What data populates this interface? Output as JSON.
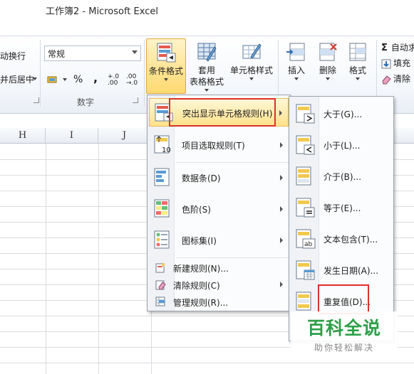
{
  "window": {
    "title": "工作簿2 - Microsoft Excel"
  },
  "ribbon": {
    "wrap_text_label": "动换行",
    "merge_center_label": "并后居中",
    "number_format_value": "常规",
    "number_group_label": "数字",
    "percent_symbol": "%",
    "comma_symbol": ",",
    "inc_decimal_label": "+.0 .00",
    "dec_decimal_label": ".00 →.0",
    "conditional_format_label": "条件格式",
    "table_format_label1": "套用",
    "table_format_label2": "表格格式",
    "cell_style_label": "单元格样式",
    "insert_label": "插入",
    "delete_label": "删除",
    "format_label": "格式",
    "autosum_label": "自动求",
    "fill_label": "填充",
    "clear_label": "清除",
    "sigma_symbol": "Σ"
  },
  "grid": {
    "columns": [
      "H",
      "I",
      "J"
    ]
  },
  "conditional_menu": {
    "items": [
      {
        "label": "突出显示单元格规则(H)",
        "icon": "highlight-rules-icon"
      },
      {
        "label": "项目选取规则(T)",
        "icon": "top-bottom-rules-icon"
      },
      {
        "label": "数据条(D)",
        "icon": "data-bars-icon"
      },
      {
        "label": "色阶(S)",
        "icon": "color-scales-icon"
      },
      {
        "label": "图标集(I)",
        "icon": "icon-sets-icon"
      }
    ],
    "small_items": [
      {
        "label": "新建规则(N)...",
        "icon": "new-rule-icon"
      },
      {
        "label": "清除规则(C)",
        "icon": "clear-rules-icon"
      },
      {
        "label": "管理规则(R)...",
        "icon": "manage-rules-icon"
      }
    ]
  },
  "highlight_submenu": {
    "items": [
      {
        "label": "大于(G)...",
        "icon": "greater-than-icon"
      },
      {
        "label": "小于(L)...",
        "icon": "less-than-icon"
      },
      {
        "label": "介于(B)...",
        "icon": "between-icon"
      },
      {
        "label": "等于(E)...",
        "icon": "equal-to-icon"
      },
      {
        "label": "文本包含(T)...",
        "icon": "text-contains-icon"
      },
      {
        "label": "发生日期(A)...",
        "icon": "date-occurring-icon"
      },
      {
        "label": "重复值(D)...",
        "icon": "duplicate-values-icon"
      }
    ]
  },
  "watermark": {
    "title": "百科全说",
    "subtitle": "助你轻松解决"
  },
  "colors": {
    "highlight": "#ffe28a",
    "annotation_red": "#e0302f",
    "watermark_green": "#2e9f49"
  }
}
